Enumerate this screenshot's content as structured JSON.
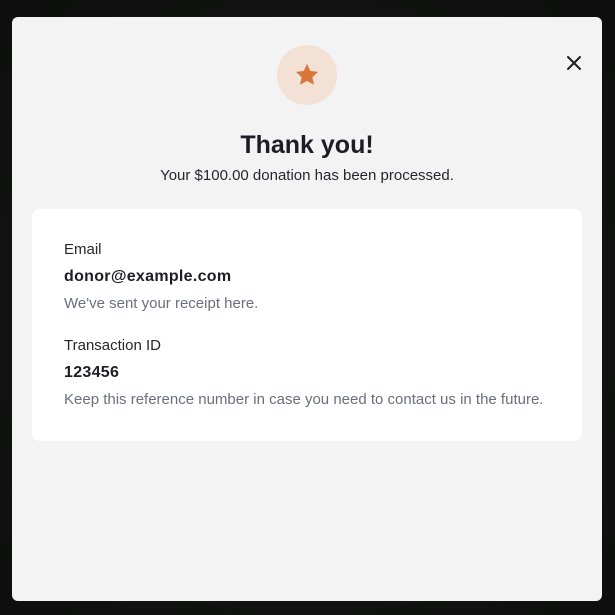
{
  "modal": {
    "title": "Thank you!",
    "subtitle": "Your $100.00 donation has been processed.",
    "icon": "star-icon",
    "close_icon": "close-icon",
    "accent_color": "#d9763a",
    "badge_color": "#f4e1d6"
  },
  "details": {
    "email": {
      "label": "Email",
      "value": "donor@example.com",
      "help": "We've sent your receipt here."
    },
    "transaction": {
      "label": "Transaction ID",
      "value": "123456",
      "help": "Keep this reference number in case you need to contact us in the future."
    }
  }
}
